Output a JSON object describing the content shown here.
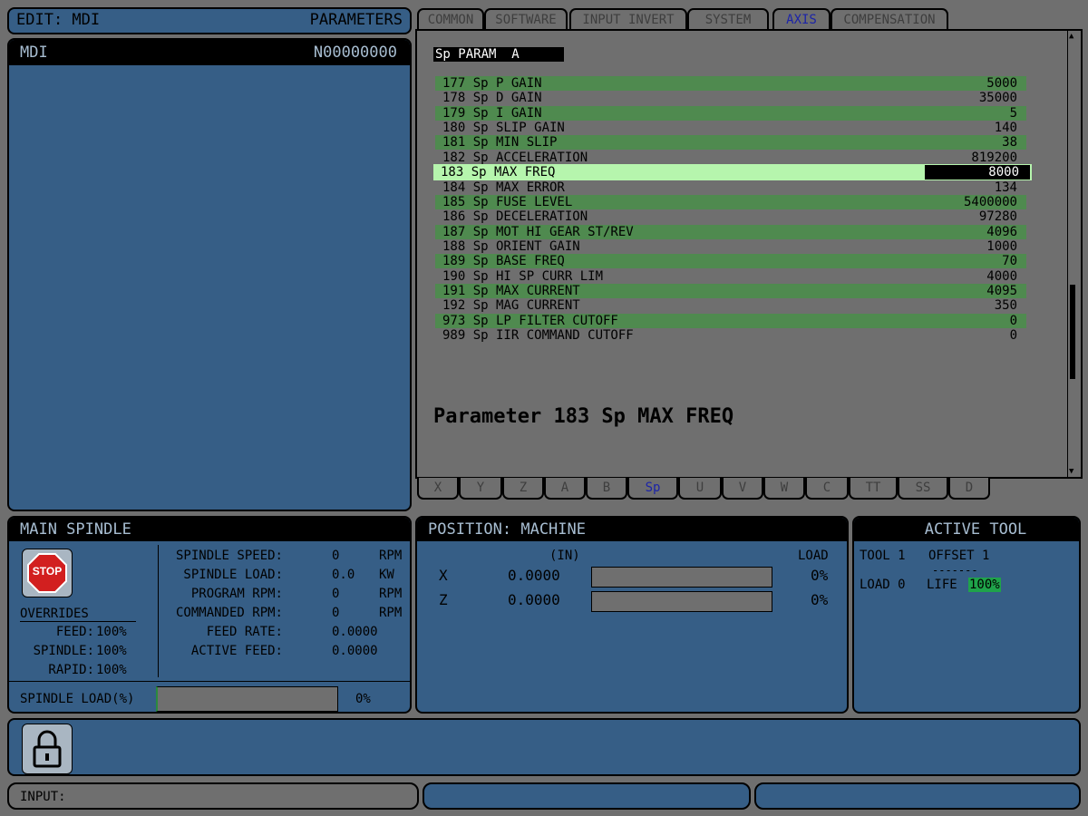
{
  "topbar": {
    "left": "EDIT:  MDI",
    "right": "PARAMETERS"
  },
  "mdi": {
    "title": "MDI",
    "n_code": "N00000000"
  },
  "tabs": [
    "COMMON",
    "SOFTWARE",
    "INPUT INVERT",
    "SYSTEM",
    "AXIS",
    "COMPENSATION"
  ],
  "active_tab": "AXIS",
  "param_header": "Sp PARAM  A",
  "params": [
    {
      "label": "177 Sp P GAIN",
      "value": "5000"
    },
    {
      "label": "178 Sp D GAIN",
      "value": "35000"
    },
    {
      "label": "179 Sp I GAIN",
      "value": "5"
    },
    {
      "label": "180 Sp SLIP GAIN",
      "value": "140"
    },
    {
      "label": "181 Sp MIN SLIP",
      "value": "38"
    },
    {
      "label": "182 Sp ACCELERATION",
      "value": "819200"
    },
    {
      "label": "183 Sp MAX FREQ",
      "value": "8000"
    },
    {
      "label": "184 Sp MAX ERROR",
      "value": "134"
    },
    {
      "label": "185 Sp FUSE LEVEL",
      "value": "5400000"
    },
    {
      "label": "186 Sp DECELERATION",
      "value": "97280"
    },
    {
      "label": "187 Sp MOT HI GEAR ST/REV",
      "value": "4096"
    },
    {
      "label": "188 Sp ORIENT GAIN",
      "value": "1000"
    },
    {
      "label": "189 Sp BASE FREQ",
      "value": "70"
    },
    {
      "label": "190 Sp HI SP CURR LIM",
      "value": "4000"
    },
    {
      "label": "191 Sp MAX CURRENT",
      "value": "4095"
    },
    {
      "label": "192 Sp MAG CURRENT",
      "value": "350"
    },
    {
      "label": "973 Sp LP FILTER CUTOFF",
      "value": "0"
    },
    {
      "label": "989 Sp IIR COMMAND CUTOFF",
      "value": "0"
    }
  ],
  "selected_param_index": 6,
  "param_description": "Parameter 183 Sp MAX FREQ",
  "axis_tabs": [
    "X",
    "Y",
    "Z",
    "A",
    "B",
    "Sp",
    "U",
    "V",
    "W",
    "C",
    "TT",
    "SS",
    "D"
  ],
  "active_axis_tab": "Sp",
  "spindle": {
    "title": "MAIN SPINDLE",
    "stop_label": "STOP",
    "overrides_title": "OVERRIDES",
    "overrides": [
      {
        "label": "FEED:",
        "value": "100%"
      },
      {
        "label": "SPINDLE:",
        "value": "100%"
      },
      {
        "label": "RAPID:",
        "value": "100%"
      }
    ],
    "readouts": [
      {
        "label": "SPINDLE SPEED:",
        "value": "0",
        "unit": "RPM"
      },
      {
        "label": "SPINDLE LOAD:",
        "value": "0.0",
        "unit": "KW"
      },
      {
        "label": "PROGRAM RPM:",
        "value": "0",
        "unit": "RPM"
      },
      {
        "label": "COMMANDED RPM:",
        "value": "0",
        "unit": "RPM"
      },
      {
        "label": "FEED RATE:",
        "value": "0.0000",
        "unit": ""
      },
      {
        "label": "ACTIVE FEED:",
        "value": "0.0000",
        "unit": ""
      }
    ],
    "load_label": "SPINDLE LOAD(%)",
    "load_value": "0%",
    "load_fraction": 0
  },
  "position": {
    "title": "POSITION:  MACHINE",
    "units": "(IN)",
    "load_header": "LOAD",
    "axes": [
      {
        "name": "X",
        "value": "0.0000",
        "load": "0%",
        "load_fraction": 0
      },
      {
        "name": "Z",
        "value": "0.0000",
        "load": "0%",
        "load_fraction": 0
      }
    ]
  },
  "active_tool": {
    "title": "ACTIVE TOOL",
    "tool": "TOOL 1",
    "offset": "OFFSET 1",
    "dashes": "-------",
    "load": "LOAD 0",
    "life_label": "LIFE",
    "life_value": "100%"
  },
  "input": {
    "label": "INPUT:"
  },
  "colors": {
    "panel_blue": "#365e86",
    "param_green": "#4f8a4f",
    "selected_row": "#b6f5ad",
    "active_tab_text": "#1c24a8",
    "life_green": "#1fa34a"
  },
  "icons": {
    "stop": "stop-sign-icon",
    "lock": "lock-icon"
  }
}
